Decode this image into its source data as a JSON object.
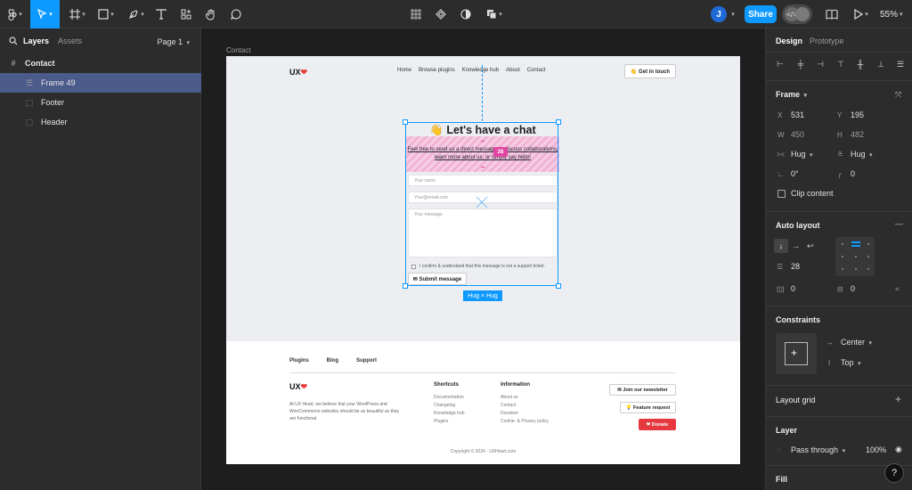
{
  "toolbar": {
    "share_label": "Share",
    "avatar_initial": "J",
    "zoom": "55%"
  },
  "left_panel": {
    "tab_layers": "Layers",
    "tab_assets": "Assets",
    "page_selector": "Page 1",
    "layers": [
      {
        "label": "Contact"
      },
      {
        "label": "Frame 49"
      },
      {
        "label": "Footer"
      },
      {
        "label": "Header"
      }
    ]
  },
  "canvas": {
    "frame_label": "Contact",
    "site": {
      "logo": "UX",
      "nav": [
        "Home",
        "Browse plugins",
        "Knowledge hub",
        "About",
        "Contact"
      ],
      "cta": "👋 Get in touch"
    },
    "chat": {
      "title": "👋 Let's have a chat",
      "intro": "Feel free to send us a direct message to discuss collaborations, learn more about us, or simply say hello!",
      "gap_value": "28",
      "name_placeholder": "Your name",
      "email_placeholder": "Your@email.com",
      "message_placeholder": "Your message",
      "consent": "I confirm & understand that this message is not a support ticket.",
      "submit": "✉ Submit message"
    },
    "selection_badge": "Hug × Hug",
    "footer": {
      "links": [
        "Plugins",
        "Blog",
        "Support"
      ],
      "logo": "UX",
      "description": "At UX Heart, we believe that your WordPress and WooCommerce websites should be as beautiful as they are functional.",
      "shortcuts_heading": "Shortcuts",
      "shortcuts": [
        "Documentation",
        "Changelog",
        "Knowledge hub",
        "Plugins"
      ],
      "information_heading": "Information",
      "information": [
        "About us",
        "Contact",
        "Donation",
        "Cookie- & Privacy policy"
      ],
      "newsletter": "✉ Join our newsletter",
      "feature_request": "💡 Feature request",
      "donate": "❤ Donate",
      "copyright": "Copyright © 2024 - UXHeart.com"
    }
  },
  "right_panel": {
    "tab_design": "Design",
    "tab_prototype": "Prototype",
    "frame_heading": "Frame",
    "x_label": "X",
    "x_value": "531",
    "y_label": "Y",
    "y_value": "195",
    "w_label": "W",
    "w_value": "450",
    "h_label": "H",
    "h_value": "482",
    "width_mode": "Hug",
    "height_mode": "Hug",
    "rotation": "0°",
    "radius": "0",
    "clip_content": "Clip content",
    "auto_layout_heading": "Auto layout",
    "gap": "28",
    "padding_h": "0",
    "padding_v": "0",
    "constraints_heading": "Constraints",
    "constraint_h": "Center",
    "constraint_v": "Top",
    "layout_grid_heading": "Layout grid",
    "layer_heading": "Layer",
    "blend_mode": "Pass through",
    "opacity": "100%",
    "fill_heading": "Fill"
  },
  "colors": {
    "accent": "#0d99ff",
    "spacing_marker": "#e246a3",
    "selected_layer": "#4a5b8c",
    "donate": "#e5393f"
  },
  "icons": [
    "figma-menu-icon",
    "move-tool-icon",
    "frame-tool-icon",
    "shape-tool-icon",
    "pen-tool-icon",
    "text-tool-icon",
    "resources-icon",
    "hand-tool-icon",
    "comment-icon",
    "component-icon",
    "mask-icon",
    "contrast-icon",
    "boolean-icon",
    "library-icon",
    "present-icon",
    "dev-mode-icon",
    "search-icon",
    "help-icon"
  ]
}
